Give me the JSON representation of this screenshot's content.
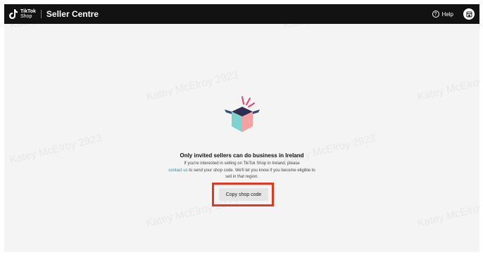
{
  "header": {
    "logo_line1": "TikTok",
    "logo_line2": "Shop",
    "title": "Seller Centre",
    "help_label": "Help",
    "icons": [
      "tiktok-note-icon",
      "question-circle-icon",
      "shop-icon"
    ]
  },
  "watermark": "Katey McElroy 2923",
  "main": {
    "heading": "Only invited sellers can do business in Ireland",
    "desc_part1": "If you're interested in selling on TikTok Shop in Ireland, please",
    "contact_link": "contact us",
    "desc_part2": "to send your shop code. We'll let you know if you become eligible to sell in that region.",
    "copy_button": "Copy shop code"
  },
  "colors": {
    "topbar": "#121212",
    "background": "#f4f4f4",
    "link": "#1a8fa0",
    "highlight": "#e2381f"
  }
}
